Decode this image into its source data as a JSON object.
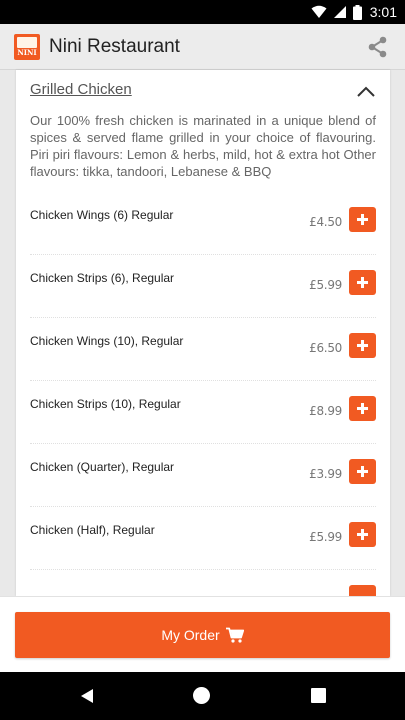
{
  "status_bar": {
    "time": "3:01"
  },
  "app_bar": {
    "logo_text": "NINI",
    "title": "Nini Restaurant"
  },
  "section": {
    "title": "Grilled Chicken",
    "description": "Our 100% fresh chicken is marinated in a unique blend of spices & served flame grilled in your choice of flavouring. Piri piri flavours: Lemon & herbs, mild, hot & extra hot Other flavours: tikka, tandoori, Lebanese & BBQ"
  },
  "items": [
    {
      "name": "Chicken Wings (6) Regular",
      "price": "£4.50"
    },
    {
      "name": "Chicken Strips (6), Regular",
      "price": "£5.99"
    },
    {
      "name": "Chicken Wings (10), Regular",
      "price": "£6.50"
    },
    {
      "name": "Chicken Strips (10), Regular",
      "price": "£8.99"
    },
    {
      "name": "Chicken (Quarter), Regular",
      "price": "£3.99"
    },
    {
      "name": "Chicken (Half), Regular",
      "price": "£5.99"
    }
  ],
  "order": {
    "label": "My Order"
  },
  "colors": {
    "accent": "#f15a22",
    "app_bar": "#ececec",
    "background": "#e9e9e9"
  },
  "icons": {
    "status": [
      "wifi-icon",
      "signal-icon",
      "battery-icon"
    ],
    "share": "share-icon",
    "collapse": "chevron-up-icon",
    "add": "plus-icon",
    "cart": "cart-icon",
    "nav": [
      "back-icon",
      "home-icon",
      "recent-apps-icon"
    ]
  }
}
